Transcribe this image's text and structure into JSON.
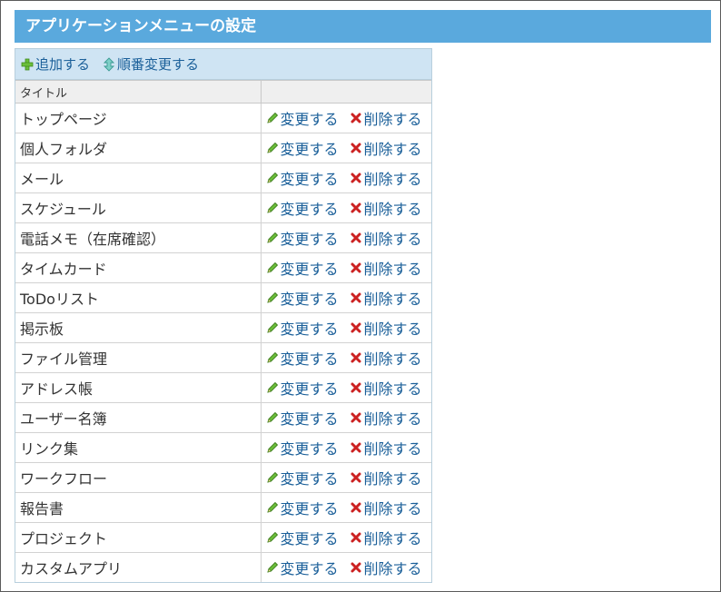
{
  "page": {
    "title": "アプリケーションメニューの設定"
  },
  "toolbar": {
    "add_label": "追加する",
    "reorder_label": "順番変更する"
  },
  "table": {
    "headers": [
      "タイトル",
      ""
    ],
    "edit_label": "変更する",
    "delete_label": "削除する",
    "rows": [
      "トップページ",
      "個人フォルダ",
      "メール",
      "スケジュール",
      "電話メモ（在席確認）",
      "タイムカード",
      "ToDoリスト",
      "掲示板",
      "ファイル管理",
      "アドレス帳",
      "ユーザー名簿",
      "リンク集",
      "ワークフロー",
      "報告書",
      "プロジェクト",
      "カスタムアプリ"
    ]
  },
  "colors": {
    "title_bar": "#5aa9dd",
    "toolbar": "#cfe4f3",
    "link": "#1a5f99",
    "delete_icon": "#cc2222",
    "edit_icon": "#5a9e2e"
  }
}
